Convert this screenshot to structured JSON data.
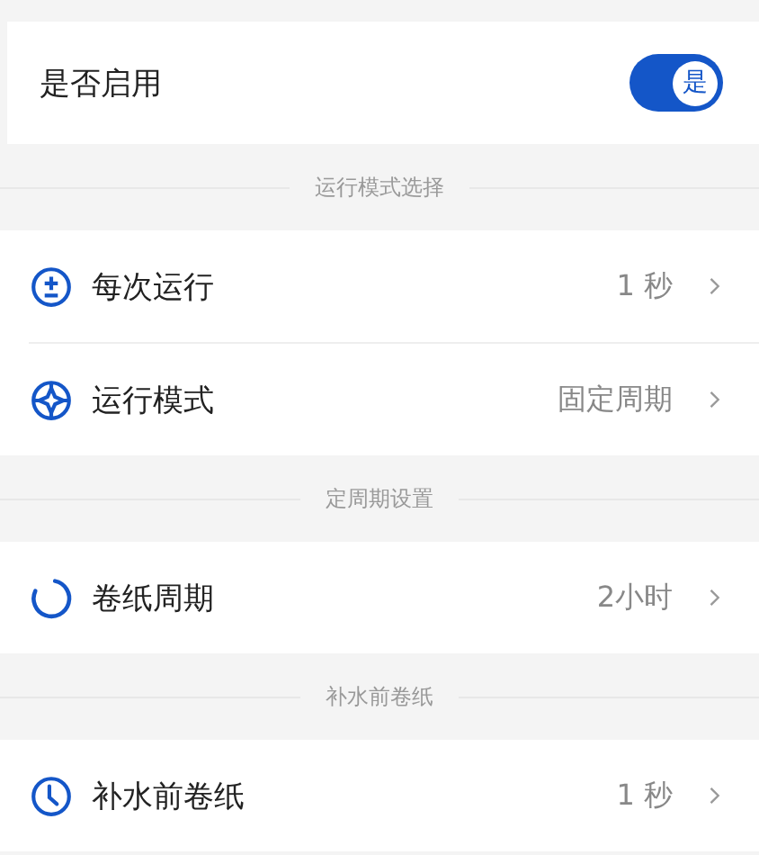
{
  "enable": {
    "label": "是否启用",
    "on": true,
    "knob_text": "是"
  },
  "sections": [
    {
      "title": "运行模式选择",
      "rows": [
        {
          "label": "每次运行",
          "value": "1 秒"
        },
        {
          "label": "运行模式",
          "value": "固定周期"
        }
      ]
    },
    {
      "title": "定周期设置",
      "rows": [
        {
          "label": "卷纸周期",
          "value": "2小时"
        }
      ]
    },
    {
      "title": "补水前卷纸",
      "rows": [
        {
          "label": "补水前卷纸",
          "value": "1 秒"
        }
      ]
    }
  ]
}
